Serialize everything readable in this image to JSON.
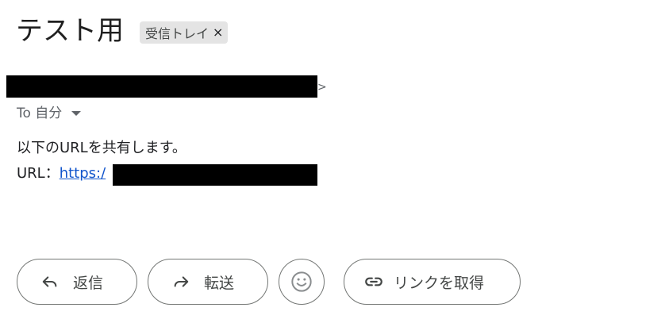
{
  "subject": "テスト用",
  "label_chip": {
    "text": "受信トレイ",
    "close": "×"
  },
  "sender": {
    "tail": ">"
  },
  "recipient": {
    "text": "To 自分"
  },
  "body": {
    "line1": "以下のURLを共有します。",
    "url_prefix": "URL：",
    "url_text": "https:/"
  },
  "actions": {
    "reply": "返信",
    "forward": "転送",
    "get_link": "リンクを取得"
  },
  "icons": [
    "reply-icon",
    "forward-icon",
    "emoji-icon",
    "link-icon",
    "chevron-down-icon",
    "close-icon"
  ],
  "colors": {
    "link": "#1155cc",
    "chip_bg": "#e4e4e4",
    "muted_text": "#5f6368",
    "border": "#747775"
  }
}
